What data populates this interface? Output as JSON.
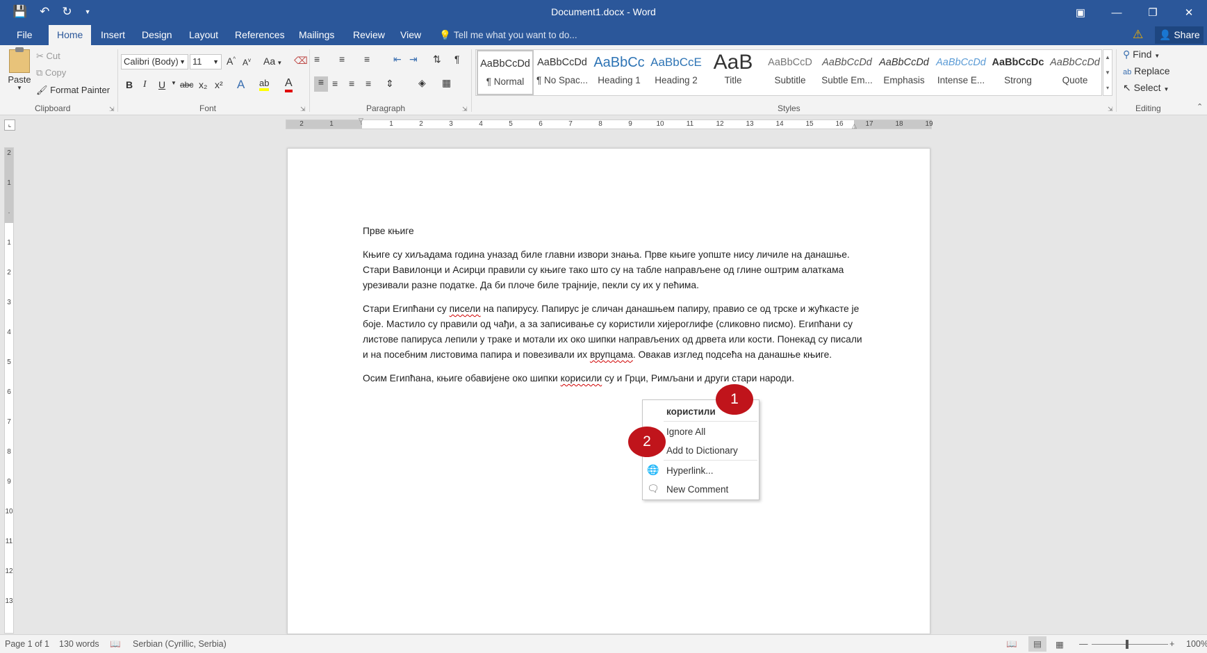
{
  "titlebar": {
    "title": "Document1.docx - Word",
    "qat": {
      "save_icon": "save-icon",
      "undo_icon": "undo-icon",
      "redo_icon": "redo-icon"
    },
    "window_controls": [
      "ribbon-display-icon",
      "minimize-icon",
      "restore-icon",
      "close-icon"
    ]
  },
  "tabs": {
    "items": [
      "File",
      "Home",
      "Insert",
      "Design",
      "Layout",
      "References",
      "Mailings",
      "Review",
      "View"
    ],
    "active": "Home",
    "tell_me": "Tell me what you want to do...",
    "share": "Share"
  },
  "clipboard": {
    "paste": "Paste",
    "cut": "Cut",
    "copy": "Copy",
    "format_painter": "Format Painter",
    "label": "Clipboard"
  },
  "font": {
    "family": "Calibri (Body)",
    "size": "11",
    "label": "Font",
    "bold": "B",
    "italic": "I",
    "underline": "U",
    "strike": "abc",
    "sub": "x₂",
    "sup": "x²",
    "change_case": "Aa",
    "grow": "A",
    "shrink": "A"
  },
  "paragraph": {
    "label": "Paragraph"
  },
  "styles": {
    "label": "Styles",
    "items": [
      {
        "preview": "AaBbCcDd",
        "name": "¶ Normal"
      },
      {
        "preview": "AaBbCcDd",
        "name": "¶ No Spac..."
      },
      {
        "preview": "AaBbCc",
        "name": "Heading 1"
      },
      {
        "preview": "AaBbCcE",
        "name": "Heading 2"
      },
      {
        "preview": "AaB",
        "name": "Title"
      },
      {
        "preview": "AaBbCcD",
        "name": "Subtitle"
      },
      {
        "preview": "AaBbCcDd",
        "name": "Subtle Em..."
      },
      {
        "preview": "AaBbCcDd",
        "name": "Emphasis"
      },
      {
        "preview": "AaBbCcDd",
        "name": "Intense E..."
      },
      {
        "preview": "AaBbCcDc",
        "name": "Strong"
      },
      {
        "preview": "AaBbCcDd",
        "name": "Quote"
      }
    ],
    "colors": {
      "heading": "#2e74b5",
      "intense": "#5b9bd5"
    }
  },
  "editing": {
    "find": "Find",
    "replace": "Replace",
    "select": "Select",
    "label": "Editing"
  },
  "ruler": {
    "h_numbers": [
      "2",
      "1",
      "",
      "1",
      "2",
      "3",
      "4",
      "5",
      "6",
      "7",
      "8",
      "9",
      "10",
      "11",
      "12",
      "13",
      "14",
      "15",
      "16",
      "17",
      "18",
      "19"
    ],
    "v_numbers": [
      "2",
      "1",
      "",
      "1",
      "2",
      "3",
      "4",
      "5",
      "6",
      "7",
      "8",
      "9",
      "10",
      "11",
      "12",
      "13"
    ]
  },
  "document": {
    "heading": "Прве књиге",
    "p1": "Књиге су хиљадама година уназад биле главни извори знања. Прве књиге уопште нису личиле на данашње. Стари Вавилонци и Асирци правили су књиге тако што су на табле направљене од глине оштрим алаткама урезивали разне податке. Да би плоче биле трајније, пекли су их у пећима.",
    "p2": {
      "t1": "Стари Египћани су ",
      "w1": "писели",
      "t2": " на папирусу. Папирус је сличан данашњем папиру, правио се од трске и жућкасте је боје. Мастило су правили од чађи, а за записивање су користили хијероглифе (сликовно писмо). Египћани су листове папируса лепили у траке и мотали их око шипки направљених од дрвета или кости. Понекад су писали и на посебним листовима папира и повезивали их ",
      "w2": "врупцама",
      "t3": ". Овакав изглед подсећа на данашње књиге."
    },
    "p3": {
      "t1": "Осим Египћана, књиге обавијене око шипки ",
      "w1": "корисили",
      "t2": " су и Грци, Римљани и други стари народи."
    }
  },
  "context_menu": {
    "suggestion": "користили",
    "ignore_all": "Ignore All",
    "add_to_dictionary": "Add to Dictionary",
    "hyperlink": "Hyperlink...",
    "new_comment": "New Comment"
  },
  "badges": [
    "1",
    "2"
  ],
  "statusbar": {
    "page": "Page 1 of 1",
    "words": "130 words",
    "language": "Serbian (Cyrillic, Serbia)",
    "zoom": "100%"
  },
  "colors": {
    "accent": "#2b579a",
    "badge": "#c0141b",
    "squiggle": "#d00000"
  }
}
